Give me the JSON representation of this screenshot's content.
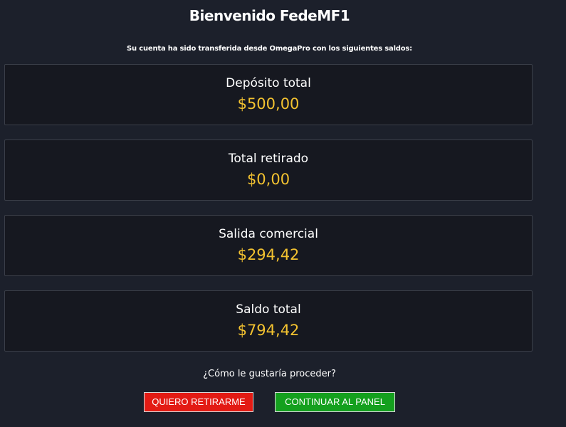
{
  "header": {
    "title": "Bienvenido FedeMF1",
    "subtitle": "Su cuenta ha sido transferida desde OmegaPro con los siguientes saldos:"
  },
  "balances": [
    {
      "label": "Depósito total",
      "value": "$500,00"
    },
    {
      "label": "Total retirado",
      "value": "$0,00"
    },
    {
      "label": "Salida comercial",
      "value": "$294,42"
    },
    {
      "label": "Saldo total",
      "value": "$794,42"
    }
  ],
  "prompt": {
    "question": "¿Cómo le gustaría proceder?"
  },
  "actions": {
    "withdraw_label": "QUIERO RETIRARME",
    "continue_label": "CONTINUAR AL PANEL"
  },
  "colors": {
    "background": "#1c202b",
    "card_background": "#161820",
    "value_accent": "#f3c230",
    "withdraw_button": "#e31b14",
    "continue_button": "#14a01e"
  }
}
